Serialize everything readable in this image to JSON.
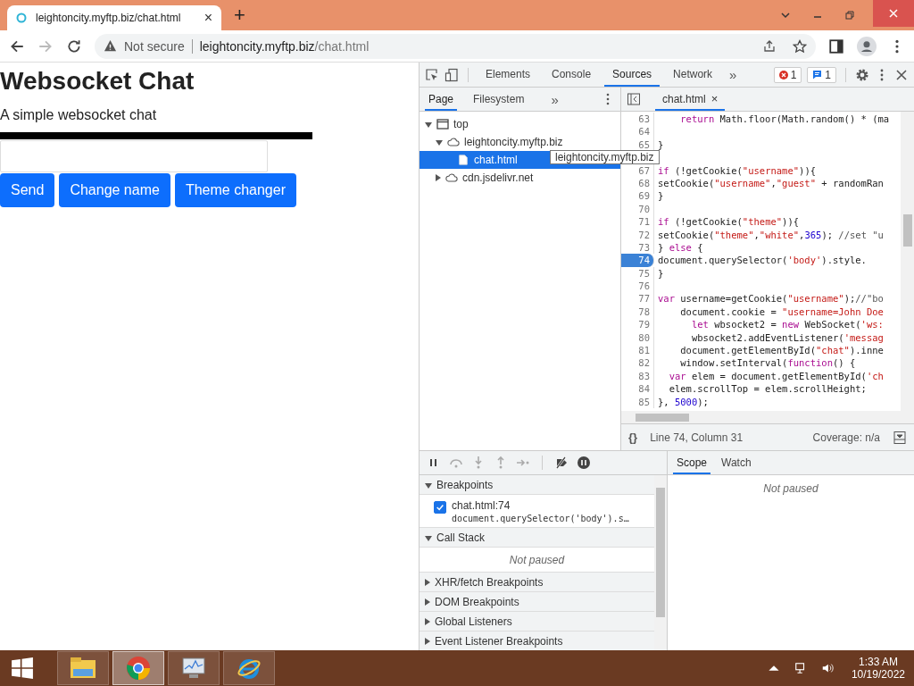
{
  "browser": {
    "tab": {
      "title": "leightoncity.myftp.biz/chat.html",
      "close": "×"
    },
    "new_tab": "+",
    "forward_disabled": true,
    "security": "Not secure",
    "url_host": "leightoncity.myftp.biz",
    "url_path": "/chat.html"
  },
  "page": {
    "title": "Websocket Chat",
    "subtitle": "A simple websocket chat",
    "buttons": [
      "Send",
      "Change name",
      "Theme changer"
    ]
  },
  "devtools": {
    "tabs": [
      {
        "label": "Elements",
        "selected": false
      },
      {
        "label": "Console",
        "selected": false
      },
      {
        "label": "Sources",
        "selected": true
      },
      {
        "label": "Network",
        "selected": false
      }
    ],
    "more": "»",
    "error_count": "1",
    "message_count": "1",
    "nav_tabs": [
      {
        "label": "Page",
        "selected": true
      },
      {
        "label": "Filesystem",
        "selected": false
      }
    ],
    "tree": [
      {
        "label": "top",
        "kind": "frame",
        "expanded": true,
        "selected": false,
        "children": [
          {
            "label": "leightoncity.myftp.biz",
            "kind": "domain",
            "expanded": true,
            "selected": false,
            "children": [
              {
                "label": "chat.html",
                "kind": "file",
                "selected": true
              }
            ]
          },
          {
            "label": "cdn.jsdelivr.net",
            "kind": "domain",
            "expanded": false,
            "selected": false
          }
        ]
      }
    ],
    "editor_tab": {
      "label": "chat.html",
      "close": "×"
    },
    "lines": [
      {
        "number": "63",
        "segs": [
          {
            "kind": "keyword",
            "text": "    return"
          },
          {
            "kind": "plain",
            "text": " Math.floor(Math.random() * (ma"
          }
        ]
      },
      {
        "number": "64"
      },
      {
        "number": "65",
        "segs": [
          {
            "kind": "plain",
            "text": "}"
          }
        ]
      },
      {
        "tooltip": "leightoncity.myftp.biz"
      },
      {
        "number": "67",
        "segs": [
          {
            "kind": "keyword",
            "text": "if"
          },
          {
            "kind": "plain",
            "text": " (!getCookie("
          },
          {
            "kind": "string",
            "text": "\"username\""
          },
          {
            "kind": "plain",
            "text": ")){"
          }
        ]
      },
      {
        "number": "68",
        "segs": [
          {
            "kind": "plain",
            "text": "setCookie("
          },
          {
            "kind": "string",
            "text": "\"username\""
          },
          {
            "kind": "plain",
            "text": ","
          },
          {
            "kind": "string",
            "text": "\"guest\""
          },
          {
            "kind": "plain",
            "text": " + randomRan"
          }
        ]
      },
      {
        "number": "69",
        "segs": [
          {
            "kind": "plain",
            "text": "}"
          }
        ]
      },
      {
        "number": "70"
      },
      {
        "number": "71",
        "segs": [
          {
            "kind": "keyword",
            "text": "if"
          },
          {
            "kind": "plain",
            "text": " (!getCookie("
          },
          {
            "kind": "string",
            "text": "\"theme\""
          },
          {
            "kind": "plain",
            "text": ")){"
          }
        ]
      },
      {
        "number": "72",
        "segs": [
          {
            "kind": "plain",
            "text": "setCookie("
          },
          {
            "kind": "string",
            "text": "\"theme\""
          },
          {
            "kind": "plain",
            "text": ","
          },
          {
            "kind": "string",
            "text": "\"white\""
          },
          {
            "kind": "plain",
            "text": ","
          },
          {
            "kind": "number",
            "text": "365"
          },
          {
            "kind": "plain",
            "text": "); "
          },
          {
            "kind": "comment",
            "text": "//set \"u"
          }
        ]
      },
      {
        "number": "73",
        "segs": [
          {
            "kind": "plain",
            "text": "} "
          },
          {
            "kind": "keyword",
            "text": "else"
          },
          {
            "kind": "plain",
            "text": " {"
          }
        ]
      },
      {
        "number": "74",
        "breakpoint": true,
        "segs": [
          {
            "kind": "plain",
            "text": "document.querySelector("
          },
          {
            "kind": "string",
            "text": "'body'"
          },
          {
            "kind": "plain",
            "text": ").style."
          }
        ]
      },
      {
        "number": "75",
        "segs": [
          {
            "kind": "plain",
            "text": "}"
          }
        ]
      },
      {
        "number": "76"
      },
      {
        "number": "77",
        "segs": [
          {
            "kind": "keyword",
            "text": "var"
          },
          {
            "kind": "plain",
            "text": " username=getCookie("
          },
          {
            "kind": "string",
            "text": "\"username\""
          },
          {
            "kind": "plain",
            "text": ");"
          },
          {
            "kind": "comment",
            "text": "//\"bo"
          }
        ]
      },
      {
        "number": "78",
        "segs": [
          {
            "kind": "plain",
            "text": "    document.cookie = "
          },
          {
            "kind": "string",
            "text": "\"username=John Doe"
          }
        ]
      },
      {
        "number": "79",
        "segs": [
          {
            "kind": "keyword",
            "text": "      let"
          },
          {
            "kind": "plain",
            "text": " wbsocket2 = "
          },
          {
            "kind": "keyword",
            "text": "new"
          },
          {
            "kind": "plain",
            "text": " WebSocket("
          },
          {
            "kind": "string",
            "text": "'ws:"
          }
        ]
      },
      {
        "number": "80",
        "segs": [
          {
            "kind": "plain",
            "text": "      wbsocket2.addEventListener("
          },
          {
            "kind": "string",
            "text": "'messag"
          }
        ]
      },
      {
        "number": "81",
        "segs": [
          {
            "kind": "plain",
            "text": "    document.getElementById("
          },
          {
            "kind": "string",
            "text": "\"chat\""
          },
          {
            "kind": "plain",
            "text": ").inne"
          }
        ]
      },
      {
        "number": "82",
        "segs": [
          {
            "kind": "plain",
            "text": "    window.setInterval("
          },
          {
            "kind": "keyword",
            "text": "function"
          },
          {
            "kind": "plain",
            "text": "() {"
          }
        ]
      },
      {
        "number": "83",
        "segs": [
          {
            "kind": "keyword",
            "text": "  var"
          },
          {
            "kind": "plain",
            "text": " elem = document.getElementById("
          },
          {
            "kind": "string",
            "text": "'ch"
          }
        ]
      },
      {
        "number": "84",
        "segs": [
          {
            "kind": "plain",
            "text": "  elem.scrollTop = elem.scrollHeight;"
          }
        ]
      },
      {
        "number": "85",
        "segs": [
          {
            "kind": "plain",
            "text": "}, "
          },
          {
            "kind": "number",
            "text": "5000"
          },
          {
            "kind": "plain",
            "text": ");"
          }
        ]
      }
    ],
    "status": {
      "format": "{}",
      "position": "Line 74, Column 31",
      "coverage": "Coverage: n/a"
    },
    "sections": [
      {
        "title": "Breakpoints",
        "expanded": true,
        "kind": "breakpoints",
        "items": [
          {
            "file": "chat.html:74",
            "code": "document.querySelector('body').s…",
            "checked": true
          }
        ]
      },
      {
        "title": "Call Stack",
        "expanded": true,
        "kind": "message",
        "message": "Not paused"
      },
      {
        "title": "XHR/fetch Breakpoints",
        "expanded": false
      },
      {
        "title": "DOM Breakpoints",
        "expanded": false
      },
      {
        "title": "Global Listeners",
        "expanded": false
      },
      {
        "title": "Event Listener Breakpoints",
        "expanded": false
      }
    ],
    "side_tabs": [
      {
        "label": "Scope",
        "selected": true
      },
      {
        "label": "Watch",
        "selected": false
      }
    ],
    "scope_message": "Not paused"
  },
  "taskbar": {
    "apps": [
      {
        "kind": "explorer",
        "selected": false
      },
      {
        "kind": "chrome",
        "selected": true
      },
      {
        "kind": "monitor",
        "selected": false
      },
      {
        "kind": "ie",
        "selected": false
      }
    ],
    "time": "1:33 AM",
    "date": "10/19/2022"
  }
}
